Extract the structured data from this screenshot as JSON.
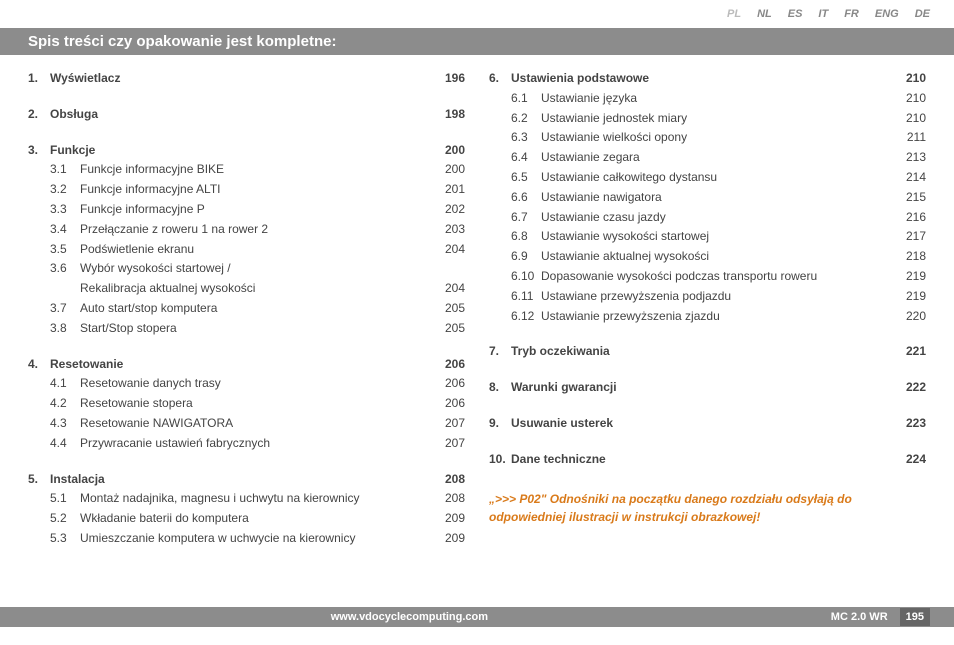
{
  "langs": [
    "PL",
    "NL",
    "ES",
    "IT",
    "FR",
    "ENG",
    "DE"
  ],
  "active_lang": "PL",
  "title": "Spis treści czy opakowanie jest kompletne:",
  "left": [
    {
      "num": "1.",
      "title": "Wyświetlacz",
      "page": "196",
      "subs": []
    },
    {
      "num": "2.",
      "title": "Obsługa",
      "page": "198",
      "subs": []
    },
    {
      "num": "3.",
      "title": "Funkcje",
      "page": "200",
      "subs": [
        {
          "num": "3.1",
          "label": "Funkcje informacyjne BIKE",
          "page": "200"
        },
        {
          "num": "3.2",
          "label": "Funkcje informacyjne ALTI",
          "page": "201"
        },
        {
          "num": "3.3",
          "label": "Funkcje informacyjne P",
          "page": "202"
        },
        {
          "num": "3.4",
          "label": "Przełączanie z roweru 1 na rower 2",
          "page": "203"
        },
        {
          "num": "3.5",
          "label": "Podświetlenie ekranu",
          "page": "204"
        },
        {
          "num": "3.6",
          "label": "Wybór wysokości startowej /",
          "page": "",
          "cont": "Rekalibracja aktualnej wysokości",
          "contpage": "204"
        },
        {
          "num": "3.7",
          "label": "Auto start/stop komputera",
          "page": "205"
        },
        {
          "num": "3.8",
          "label": "Start/Stop stopera",
          "page": "205"
        }
      ]
    },
    {
      "num": "4.",
      "title": "Resetowanie",
      "page": "206",
      "subs": [
        {
          "num": "4.1",
          "label": "Resetowanie danych trasy",
          "page": "206"
        },
        {
          "num": "4.2",
          "label": "Resetowanie stopera",
          "page": "206"
        },
        {
          "num": "4.3",
          "label": "Resetowanie NAWIGATORA",
          "page": "207"
        },
        {
          "num": "4.4",
          "label": "Przywracanie ustawień fabrycznych",
          "page": "207"
        }
      ]
    },
    {
      "num": "5.",
      "title": "Instalacja",
      "page": "208",
      "subs": [
        {
          "num": "5.1",
          "label": "Montaż nadajnika, magnesu i uchwytu na kierownicy",
          "page": "208"
        },
        {
          "num": "5.2",
          "label": "Wkładanie baterii do komputera",
          "page": "209"
        },
        {
          "num": "5.3",
          "label": "Umieszczanie komputera w uchwycie na kierownicy",
          "page": "209"
        }
      ]
    }
  ],
  "right": [
    {
      "num": "6.",
      "title": "Ustawienia podstawowe",
      "page": "210",
      "subs": [
        {
          "num": "6.1",
          "label": "Ustawianie języka",
          "page": "210"
        },
        {
          "num": "6.2",
          "label": "Ustawianie jednostek miary",
          "page": "210"
        },
        {
          "num": "6.3",
          "label": "Ustawianie wielkości opony",
          "page": "211"
        },
        {
          "num": "6.4",
          "label": "Ustawianie zegara",
          "page": "213"
        },
        {
          "num": "6.5",
          "label": "Ustawianie całkowitego dystansu",
          "page": "214"
        },
        {
          "num": "6.6",
          "label": "Ustawianie nawigatora",
          "page": "215"
        },
        {
          "num": "6.7",
          "label": "Ustawianie czasu jazdy",
          "page": "216"
        },
        {
          "num": "6.8",
          "label": "Ustawianie wysokości startowej",
          "page": "217"
        },
        {
          "num": "6.9",
          "label": "Ustawianie aktualnej wysokości",
          "page": "218"
        },
        {
          "num": "6.10",
          "label": "Dopasowanie wysokości podczas transportu roweru",
          "page": "219"
        },
        {
          "num": "6.11",
          "label": "Ustawiane przewyższenia podjazdu",
          "page": "219"
        },
        {
          "num": "6.12",
          "label": "Ustawianie przewyższenia zjazdu",
          "page": "220"
        }
      ]
    },
    {
      "num": "7.",
      "title": "Tryb oczekiwania",
      "page": "221",
      "subs": []
    },
    {
      "num": "8.",
      "title": "Warunki gwarancji",
      "page": "222",
      "subs": []
    },
    {
      "num": "9.",
      "title": "Usuwanie usterek",
      "page": "223",
      "subs": []
    },
    {
      "num": "10.",
      "title": "Dane techniczne",
      "page": "224",
      "subs": []
    }
  ],
  "note": "„>>> P02\" Odnośniki na początku danego rozdziału odsyłają do odpowiedniej ilustracji w instrukcji obrazkowej!",
  "footer": {
    "url": "www.vdocyclecomputing.com",
    "model": "MC 2.0 WR",
    "page": "195"
  }
}
